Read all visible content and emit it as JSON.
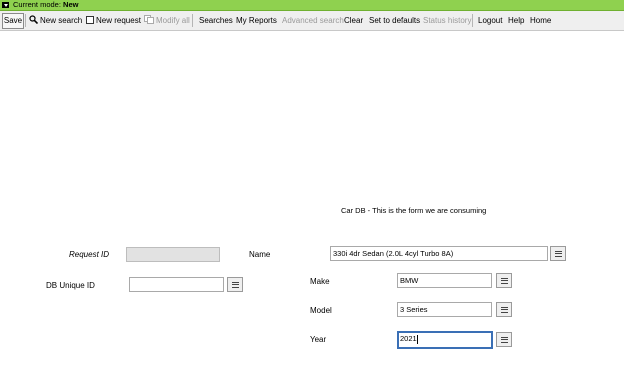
{
  "mode_bar": {
    "label": "Current mode:",
    "mode": "New"
  },
  "toolbar": {
    "save": "Save",
    "new_search": "New search",
    "new_request": "New request",
    "modify_all": "Modify all",
    "searches": "Searches",
    "my_reports": "My Reports",
    "advanced_search": "Advanced search",
    "clear": "Clear",
    "set_to_defaults": "Set to defaults",
    "status_history": "Status history",
    "logout": "Logout",
    "help": "Help",
    "home": "Home"
  },
  "form": {
    "title": "Car DB - This is the form we are consuming",
    "request_id": {
      "label": "Request ID",
      "value": ""
    },
    "db_unique_id": {
      "label": "DB Unique ID",
      "value": ""
    },
    "name": {
      "label": "Name",
      "value": "330i 4dr Sedan (2.0L 4cyl Turbo 8A)"
    },
    "make": {
      "label": "Make",
      "value": "BMW"
    },
    "model": {
      "label": "Model",
      "value": "3 Series"
    },
    "year": {
      "label": "Year",
      "value": "2021"
    }
  },
  "colors": {
    "mode_bar": "#8fd14f",
    "toolbar": "#efefef",
    "focus": "#3a6fb5"
  }
}
